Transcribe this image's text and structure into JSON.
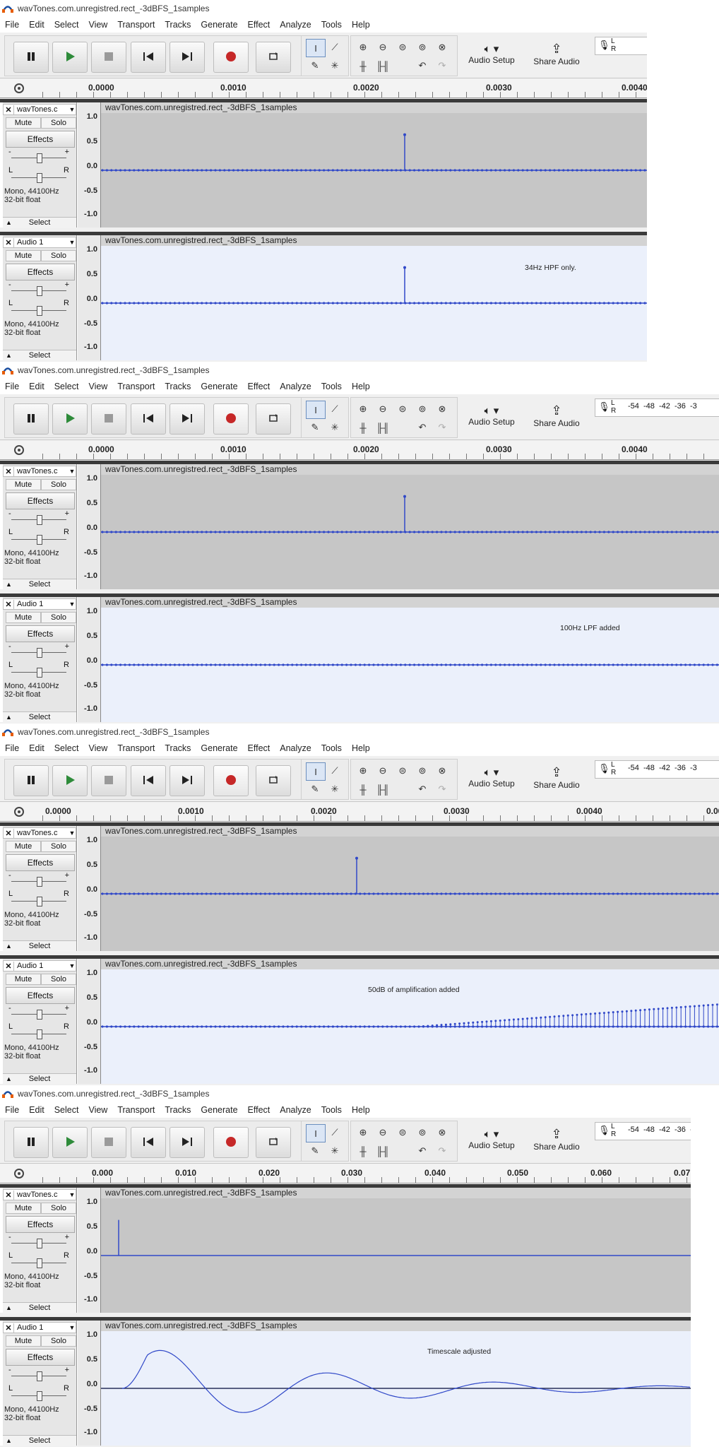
{
  "app": {
    "window_title": "wavTones.com.unregistred.rect_-3dBFS_1samples",
    "menus": [
      "File",
      "Edit",
      "Select",
      "View",
      "Transport",
      "Tracks",
      "Generate",
      "Effect",
      "Analyze",
      "Tools",
      "Help"
    ],
    "audio_setup_label": "Audio Setup",
    "share_audio_label": "Share Audio",
    "meter_lr": [
      "L",
      "R"
    ],
    "meter_ticks": [
      "-54",
      "-48",
      "-42",
      "-36",
      "-3"
    ]
  },
  "tracks": {
    "track1_name": "wavTones.c",
    "track2_name": "Audio 1",
    "clip_name": "wavTones.com.unregistred.rect_-3dBFS_1samples",
    "mute_label": "Mute",
    "solo_label": "Solo",
    "effects_label": "Effects",
    "gain_minus": "-",
    "gain_plus": "+",
    "pan_l": "L",
    "pan_r": "R",
    "format_line1": "Mono, 44100Hz",
    "format_line2": "32-bit float",
    "select_label": "Select",
    "vruler_labels": [
      "1.0",
      "0.5",
      "0.0",
      "-0.5",
      "-1.0"
    ]
  },
  "panels": [
    {
      "ruler_ticks": [
        "0.0000",
        "0.0010",
        "0.0020",
        "0.0030",
        "0.0040"
      ],
      "note": "34Hz HPF only.",
      "show_meter_ticks": false
    },
    {
      "ruler_ticks": [
        "0.0000",
        "0.0010",
        "0.0020",
        "0.0030",
        "0.0040"
      ],
      "note": "100Hz LPF added",
      "show_meter_ticks": true
    },
    {
      "ruler_ticks": [
        "0.0000",
        "0.0010",
        "0.0020",
        "0.0030",
        "0.0040",
        "0.00"
      ],
      "note": "50dB of amplification added",
      "show_meter_ticks": true
    },
    {
      "ruler_ticks": [
        "0.000",
        "0.010",
        "0.020",
        "0.030",
        "0.040",
        "0.050",
        "0.060",
        "0.07"
      ],
      "note": "Timescale adjusted",
      "show_meter_ticks": true
    }
  ],
  "colors": {
    "wave": "#3048c8",
    "track_bg_selected": "#ebf0fb",
    "track_bg": "#c6c6c6",
    "record": "#c62828",
    "play": "#2e8b3a"
  }
}
